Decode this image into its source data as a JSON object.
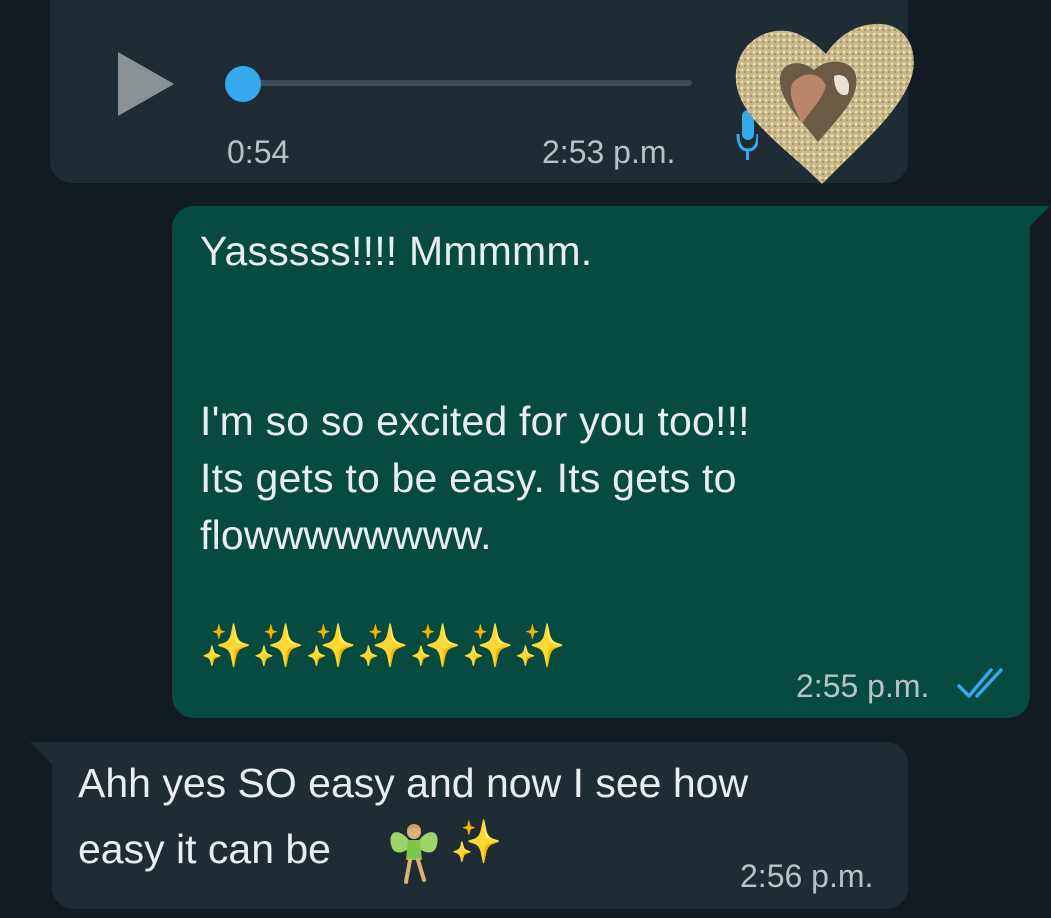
{
  "voice_message": {
    "duration": "0:54",
    "time": "2:53 p.m.",
    "progress": 0.0,
    "play_icon": "play-icon",
    "mic_icon": "mic-icon",
    "accent_color": "#35a9ec"
  },
  "outgoing_message": {
    "line1": "Yasssss!!!! Mmmmm.",
    "line2": "I'm so so excited for you too!!!",
    "line3": "Its gets to be easy. Its gets to",
    "line4": "flowwwwwwww.",
    "sparkles": "✨✨✨✨✨✨✨",
    "time": "2:55 p.m.",
    "status_icon": "double-check-icon",
    "bubble_color": "#064a40"
  },
  "incoming_message": {
    "line1": "Ahh yes SO easy and now I see how",
    "line2": "easy it can be",
    "sparkle": "✨",
    "time": "2:56 p.m.",
    "bubble_color": "#202c33"
  }
}
